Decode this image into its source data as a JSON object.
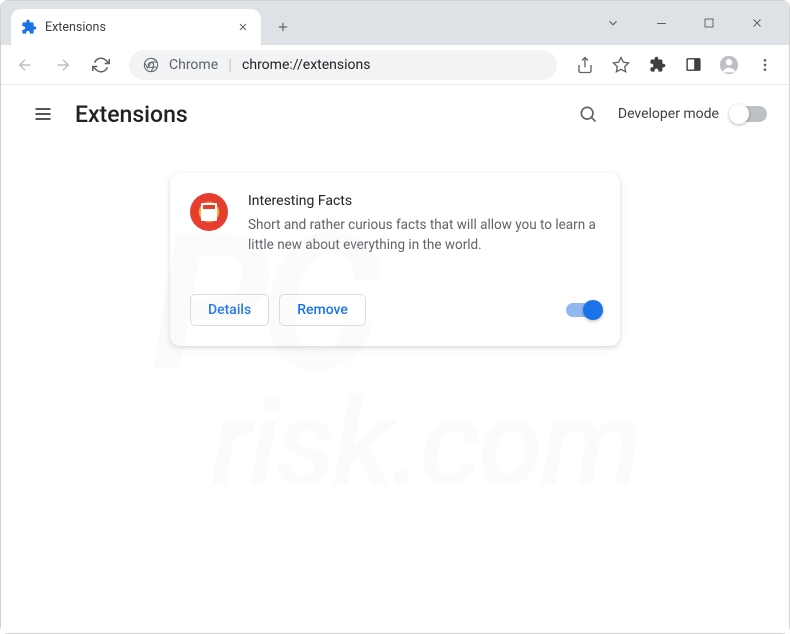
{
  "tab": {
    "title": "Extensions"
  },
  "address": {
    "prefix": "Chrome",
    "url": "chrome://extensions"
  },
  "page": {
    "title": "Extensions",
    "dev_mode_label": "Developer mode"
  },
  "extension": {
    "name": "Interesting Facts",
    "description": "Short and rather curious facts that will allow you to learn a little new about everything in the world.",
    "details_label": "Details",
    "remove_label": "Remove",
    "enabled": true
  },
  "watermark": {
    "line1": "PC",
    "line2": "risk.com"
  }
}
